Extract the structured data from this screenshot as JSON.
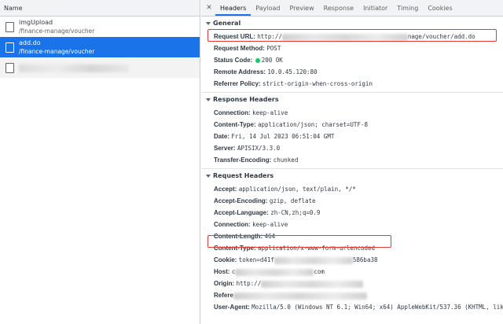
{
  "left": {
    "header": "Name",
    "requests": [
      {
        "name": "imgUpload",
        "path": "/finance-manage/voucher"
      },
      {
        "name": "add.do",
        "path": "/finance-manage/voucher"
      }
    ]
  },
  "tabs": [
    "Headers",
    "Payload",
    "Preview",
    "Response",
    "Initiator",
    "Timing",
    "Cookies"
  ],
  "general": {
    "title": "General",
    "request_url_key": "Request URL:",
    "request_url_prefix": "http://",
    "request_url_suffix": "nage/voucher/add.do",
    "request_method_key": "Request Method:",
    "request_method": "POST",
    "status_code_key": "Status Code:",
    "status_code": "200 OK",
    "remote_address_key": "Remote Address:",
    "remote_address": "10.0.45.120:80",
    "referrer_policy_key": "Referrer Policy:",
    "referrer_policy": "strict-origin-when-cross-origin"
  },
  "response_headers": {
    "title": "Response Headers",
    "rows": [
      {
        "k": "Connection:",
        "v": "keep-alive"
      },
      {
        "k": "Content-Type:",
        "v": "application/json; charset=UTF-8"
      },
      {
        "k": "Date:",
        "v": "Fri, 14 Jul 2023 06:51:04 GMT"
      },
      {
        "k": "Server:",
        "v": "APISIX/3.3.0"
      },
      {
        "k": "Transfer-Encoding:",
        "v": "chunked"
      }
    ]
  },
  "request_headers": {
    "title": "Request Headers",
    "rows": [
      {
        "k": "Accept:",
        "v": "application/json, text/plain, */*"
      },
      {
        "k": "Accept-Encoding:",
        "v": "gzip, deflate"
      },
      {
        "k": "Accept-Language:",
        "v": "zh-CN,zh;q=0.9"
      },
      {
        "k": "Connection:",
        "v": "keep-alive"
      },
      {
        "k": "Content-Length:",
        "v": "464"
      },
      {
        "k": "Content-Type:",
        "v": "application/x-www-form-urlencoded"
      }
    ],
    "cookie_key": "Cookie:",
    "cookie_prefix": "token=d41f",
    "cookie_suffix": "586ba38",
    "host_key": "Host:",
    "host_prefix": "c",
    "host_suffix": "com",
    "origin_key": "Origin:",
    "origin_prefix": "http://",
    "referer_key": "Refere",
    "user_agent_key": "User-Agent:",
    "user_agent": "Mozilla/5.0 (Windows NT 6.1; Win64; x64) AppleWebKit/537.36 (KHTML, like"
  },
  "colors": {
    "selected_row": "#1a73e8",
    "highlight_box": "#e53935",
    "status_dot": "#0cce6b"
  }
}
